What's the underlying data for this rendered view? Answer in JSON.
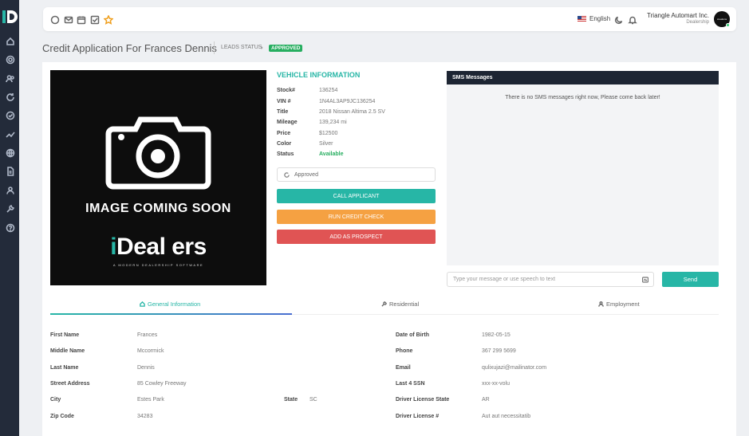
{
  "sidebar": {
    "items": [
      "dashboard-icon",
      "target-icon",
      "users-icon",
      "refresh-icon",
      "check-circle-icon",
      "trending-up-icon",
      "globe-icon",
      "document-icon",
      "user-group-icon",
      "wrench-icon",
      "help-icon"
    ]
  },
  "topbar": {
    "language": "English",
    "company_name": "Triangle Automart Inc.",
    "company_role": "Dealership",
    "avatar_text": "creations"
  },
  "header": {
    "title": "Credit Application For Frances Dennis",
    "leads_status_label": "LEADS STATUS",
    "status_badge": "APPROVED"
  },
  "photo": {
    "caption": "IMAGE COMING SOON",
    "brand_i": "i",
    "brand_rest": "Deal ers",
    "brand_sub": "A MODERN DEALERSHIP SOFTWARE"
  },
  "vehicle": {
    "title": "VEHICLE INFORMATION",
    "rows": [
      {
        "k": "Stock#",
        "v": "136254"
      },
      {
        "k": "VIN #",
        "v": "1N4AL3AP9JC136254"
      },
      {
        "k": "Title",
        "v": "2018 Nissan Altima 2.5 SV"
      },
      {
        "k": "Mileage",
        "v": "139,234 mi"
      },
      {
        "k": "Price",
        "v": "$12500"
      },
      {
        "k": "Color",
        "v": "Silver"
      },
      {
        "k": "Status",
        "v": "Available"
      }
    ],
    "status_select": "Approved",
    "btn_call": "CALL APPLICANT",
    "btn_credit": "RUN CREDIT CHECK",
    "btn_prospect": "ADD AS PROSPECT"
  },
  "sms": {
    "header": "SMS Messages",
    "empty": "There is no SMS messages right now, Please come back later!",
    "placeholder": "Type your message or use speech to text",
    "send": "Send"
  },
  "tabs": [
    {
      "label": "General Information",
      "icon": "home-icon",
      "active": true
    },
    {
      "label": "Residential",
      "icon": "tool-icon",
      "active": false
    },
    {
      "label": "Employment",
      "icon": "user-icon",
      "active": false
    }
  ],
  "general": {
    "left": [
      {
        "k": "First Name",
        "v": "Frances"
      },
      {
        "k": "Middle Name",
        "v": "Mccormick"
      },
      {
        "k": "Last Name",
        "v": "Dennis"
      },
      {
        "k": "Street Address",
        "v": "85 Cowley Freeway"
      },
      {
        "k": "City",
        "v": "Estes Park"
      },
      {
        "k": "Zip Code",
        "v": "34283"
      }
    ],
    "state": {
      "k": "State",
      "v": "SC"
    },
    "right": [
      {
        "k": "Date of Birth",
        "v": "1982-05-15"
      },
      {
        "k": "Phone",
        "v": "367 299 5699"
      },
      {
        "k": "Email",
        "v": "qulixujazi@mailinator.com"
      },
      {
        "k": "Last 4 SSN",
        "v": "xxx-xx-volu"
      },
      {
        "k": "Driver License State",
        "v": "AR"
      },
      {
        "k": "Driver License #",
        "v": "Aut aut necessitatib"
      }
    ]
  },
  "colors": {
    "accent": "#27b6a6",
    "sidebar": "#232b3a",
    "approved": "#27ae60",
    "warning": "#f5a142",
    "danger": "#e05454"
  }
}
